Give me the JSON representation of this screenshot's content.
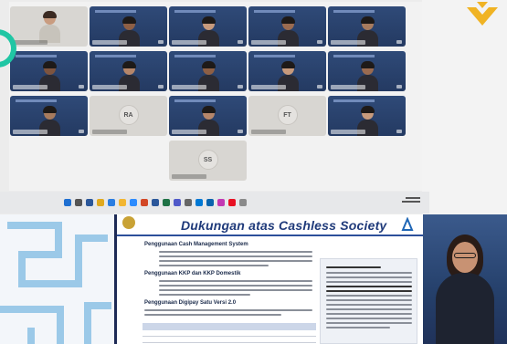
{
  "meeting": {
    "tiles": [
      {
        "kind": "avatar-photo"
      },
      {
        "kind": "video"
      },
      {
        "kind": "video"
      },
      {
        "kind": "video"
      },
      {
        "kind": "video"
      },
      {
        "kind": "video"
      },
      {
        "kind": "video"
      },
      {
        "kind": "video"
      },
      {
        "kind": "video"
      },
      {
        "kind": "video"
      },
      {
        "kind": "video"
      },
      {
        "kind": "initials",
        "text": "RA"
      },
      {
        "kind": "video"
      },
      {
        "kind": "initials",
        "text": "FT"
      },
      {
        "kind": "video"
      },
      {
        "kind": "initials",
        "text": "SS"
      }
    ],
    "accent_color": "#20c6a4",
    "tile_color": "#2f4a78"
  },
  "taskbar": {
    "icons": [
      "windows-icon",
      "search-icon",
      "task-view-icon",
      "chrome-icon",
      "edge-icon",
      "folder-icon",
      "zoom-icon",
      "powerpoint-icon",
      "word-icon",
      "excel-icon",
      "teams-icon",
      "settings-icon",
      "store-icon",
      "mail-icon",
      "photos-icon",
      "media-icon",
      "notes-icon"
    ]
  },
  "slide": {
    "title_plain": "Dukungan atas ",
    "title_em": "Cashless Society",
    "section1": "Penggunaan Cash Management System",
    "section2": "Penggunaan KKP dan KKP Domestik",
    "section3": "Penggunaan Digipay Satu Versi 2.0"
  }
}
